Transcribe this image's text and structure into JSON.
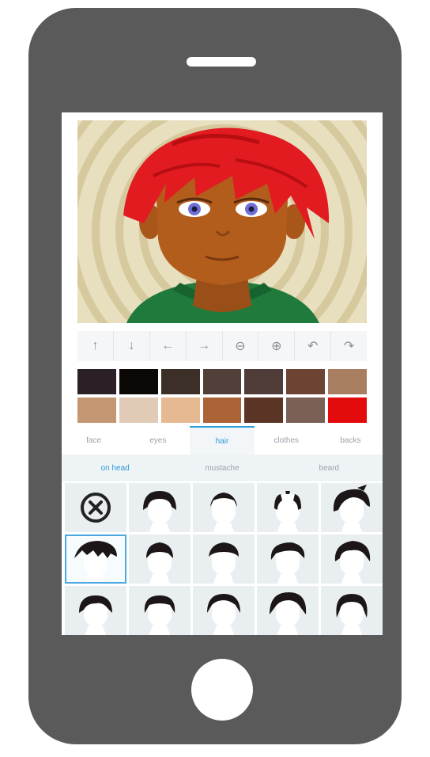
{
  "colors": {
    "phone": "#5a5a5a",
    "accent": "#2a9bd6",
    "hair": "#e21b20",
    "skin": "#b35d1c",
    "shirt": "#1f7a3b",
    "swatches_row1": [
      "#2a2026",
      "#0b0806",
      "#3b2f27",
      "#514039",
      "#4f3c38",
      "#6d4333",
      "#a87e60"
    ],
    "swatches_row2": [
      "#c49671",
      "#e1cbb6",
      "#e6b992",
      "#ab6235",
      "#5a3425",
      "#7b6056",
      "#e30b0b"
    ]
  },
  "toolbar": {
    "tools": [
      {
        "icon": "arrow-up-icon",
        "glyph": "↑"
      },
      {
        "icon": "arrow-down-icon",
        "glyph": "↓"
      },
      {
        "icon": "arrow-left-icon",
        "glyph": "←"
      },
      {
        "icon": "arrow-right-icon",
        "glyph": "→"
      },
      {
        "icon": "zoom-out-icon",
        "glyph": "⊖"
      },
      {
        "icon": "zoom-in-icon",
        "glyph": "⊕"
      },
      {
        "icon": "undo-icon",
        "glyph": "↶"
      },
      {
        "icon": "redo-icon",
        "glyph": "↷"
      }
    ]
  },
  "tabs": {
    "face": "face",
    "eyes": "eyes",
    "hair": "hair",
    "clothes": "clothes",
    "backs": "backs",
    "active": "hair"
  },
  "subtabs": {
    "on_head": "on head",
    "mustache": "mustache",
    "beard": "beard",
    "active": "on head"
  },
  "hair_grid": {
    "selected_index": 5,
    "styles": [
      "remove-hair-icon",
      "hair-style-short-icon",
      "hair-style-bald-icon",
      "hair-style-balding-icon",
      "hair-style-spiky-icon",
      "hair-style-messy-icon",
      "hair-style-crop-icon",
      "hair-style-flat-icon",
      "hair-style-swept-icon",
      "hair-style-quiff-icon",
      "hair-style-side-part-icon",
      "hair-style-round-icon",
      "hair-style-curved-icon",
      "hair-style-full-icon",
      "hair-style-long-icon"
    ]
  }
}
